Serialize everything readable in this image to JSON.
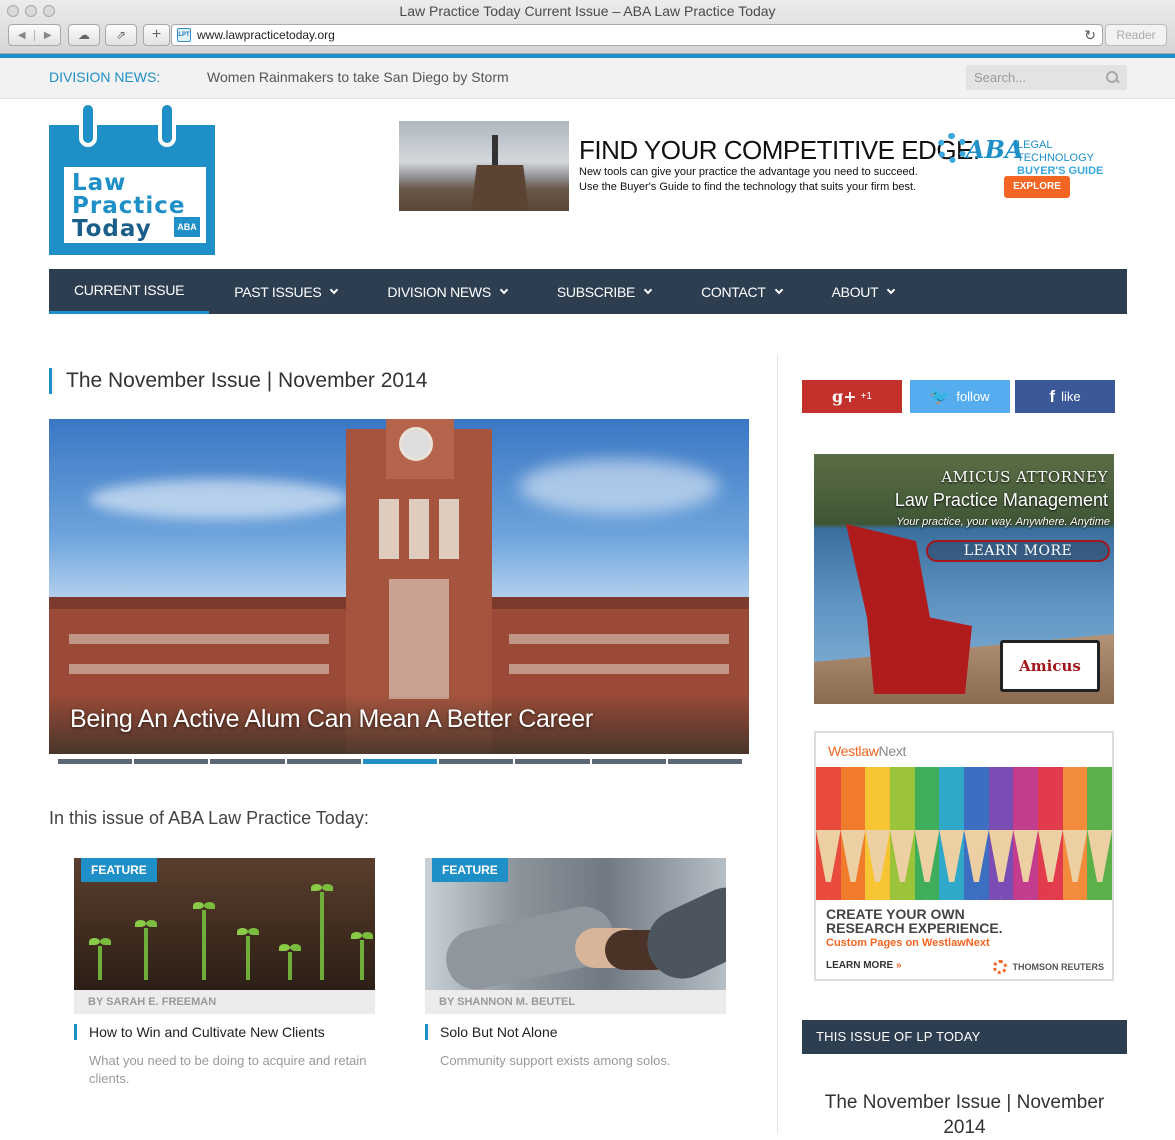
{
  "window": {
    "title": "Law Practice Today Current Issue – ABA Law Practice Today",
    "url": "www.lawpracticetoday.org",
    "reader_label": "Reader",
    "favicon_text": "LPT"
  },
  "topbar": {
    "division_news_label": "DIVISION NEWS:",
    "division_news_headline": "Women Rainmakers to take San Diego by Storm",
    "search_placeholder": "Search..."
  },
  "logo": {
    "line1": "Law",
    "line2": "Practice",
    "line3": "Today",
    "badge": "ABA"
  },
  "top_ad": {
    "headline": "FIND YOUR COMPETITIVE EDGE.",
    "sub1": "New tools can give your practice the advantage you need to succeed.",
    "sub2": "Use the Buyer's Guide to find the technology that suits your firm best.",
    "aba": "ABA",
    "brand1": "LEGAL TECHNOLOGY",
    "brand2": "BUYER'S GUIDE",
    "cta": "EXPLORE"
  },
  "nav": {
    "items": [
      {
        "label": "CURRENT ISSUE",
        "dropdown": false,
        "active": true
      },
      {
        "label": "PAST ISSUES",
        "dropdown": true
      },
      {
        "label": "DIVISION NEWS",
        "dropdown": true
      },
      {
        "label": "SUBSCRIBE",
        "dropdown": true
      },
      {
        "label": "CONTACT",
        "dropdown": true
      },
      {
        "label": "ABOUT",
        "dropdown": true
      }
    ]
  },
  "main": {
    "issue_title": "The November Issue | November 2014",
    "hero_caption": "Being An Active Alum Can Mean A Better Career",
    "slider_count": 9,
    "slider_active_index": 4,
    "section_heading": "In this issue of ABA Law Practice Today:",
    "cards": [
      {
        "badge": "FEATURE",
        "byline": "BY SARAH E. FREEMAN",
        "title": "How to Win and Cultivate New Clients",
        "description": "What you need to be doing to acquire and retain clients."
      },
      {
        "badge": "FEATURE",
        "byline": "BY SHANNON M. BEUTEL",
        "title": "Solo But Not Alone",
        "description": "Community support exists among solos."
      }
    ]
  },
  "sidebar": {
    "social": {
      "gplus_icon": "g+",
      "gplus_label": "+1",
      "twitter_label": "follow",
      "facebook_icon": "f",
      "facebook_label": "like"
    },
    "amicus_ad": {
      "title": "AMICUS ATTORNEY",
      "subtitle": "Law Practice Management",
      "tagline": "Your practice, your way. Anywhere. Anytime",
      "cta": "LEARN MORE",
      "device_text": "Amicus"
    },
    "westlaw_ad": {
      "logo_main": "Westlaw",
      "logo_suffix": "Next",
      "headline1": "CREATE YOUR OWN",
      "headline2": "RESEARCH EXPERIENCE.",
      "subline": "Custom Pages on WestlawNext",
      "cta": "LEARN MORE",
      "cta_arrow": "»",
      "company": "THOMSON REUTERS",
      "pencil_colors": [
        "#e84a3b",
        "#f07b2a",
        "#f7c533",
        "#9bc43b",
        "#3fae5a",
        "#2fa8c9",
        "#3c6fc1",
        "#7a4db5",
        "#c33d8f",
        "#e23b4e",
        "#f28b3c",
        "#5bb04a"
      ]
    },
    "this_issue_header": "THIS ISSUE OF LP TODAY",
    "this_issue_title": "The November Issue | November 2014"
  }
}
